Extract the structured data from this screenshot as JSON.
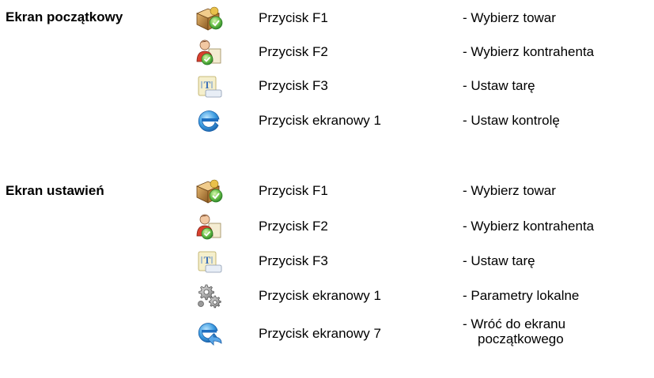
{
  "sections": [
    {
      "title": "Ekran początkowy"
    },
    {
      "title": "Ekran ustawień"
    }
  ],
  "rows": [
    {
      "section": 0,
      "icon": "product-box-icon",
      "button": "Przycisk F1",
      "action": "- Wybierz towar"
    },
    {
      "section": 0,
      "icon": "customer-person-icon",
      "button": "Przycisk F2",
      "action": "- Wybierz kontrahenta"
    },
    {
      "section": 0,
      "icon": "tare-icon",
      "button": "Przycisk F3",
      "action": "- Ustaw tarę"
    },
    {
      "section": 0,
      "icon": "control-e-icon",
      "button": "Przycisk ekranowy 1",
      "action": "- Ustaw kontrolę"
    },
    {
      "section": 1,
      "icon": "product-box-icon",
      "button": "Przycisk F1",
      "action": "- Wybierz towar"
    },
    {
      "section": 1,
      "icon": "customer-person-icon",
      "button": "Przycisk F2",
      "action": "- Wybierz kontrahenta"
    },
    {
      "section": 1,
      "icon": "tare-icon",
      "button": "Przycisk F3",
      "action": "- Ustaw tarę"
    },
    {
      "section": 1,
      "icon": "gears-icon",
      "button": "Przycisk ekranowy 1",
      "action": "- Parametry lokalne"
    },
    {
      "section": 1,
      "icon": "return-home-icon",
      "button": "Przycisk ekranowy 7",
      "action_line1": "- Wróć do ekranu",
      "action_line2": "początkowego"
    }
  ]
}
